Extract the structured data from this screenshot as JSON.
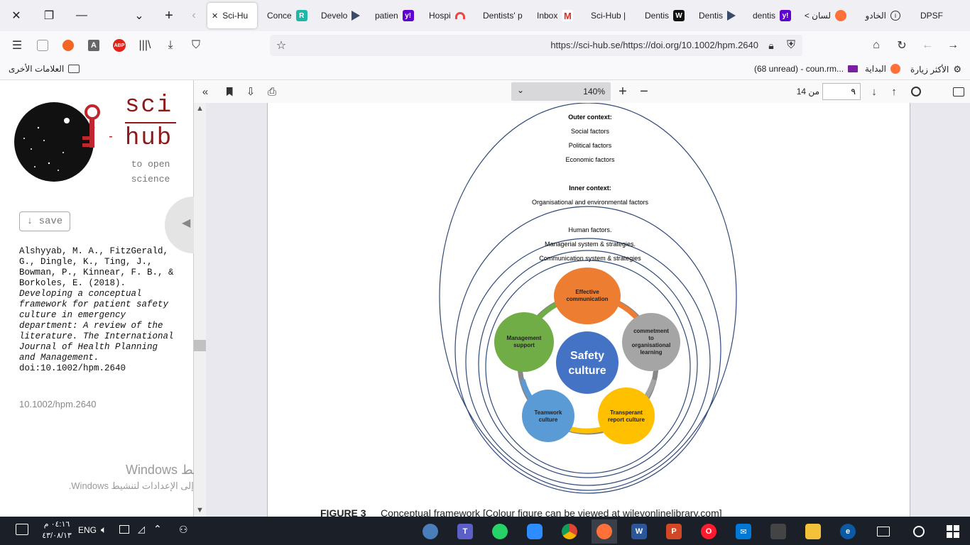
{
  "tabs": [
    {
      "label": "Sci-Hu",
      "active": true
    },
    {
      "label": "Conce",
      "favtext": "R"
    },
    {
      "label": "Develo"
    },
    {
      "label": "patien",
      "favtext": "y!"
    },
    {
      "label": "Hospi"
    },
    {
      "label": "Dentists' p"
    },
    {
      "label": "Inbox",
      "favtext": "M"
    },
    {
      "label": "Sci-Hub |"
    },
    {
      "label": "Dentis",
      "favtext": "W"
    },
    {
      "label": "Dentis"
    },
    {
      "label": "dentis",
      "favtext": "y!"
    },
    {
      "label": "لسان >"
    },
    {
      "label": "الخادو"
    },
    {
      "label": "DPSF"
    }
  ],
  "url": "https://sci-hub.se/https://doi.org/10.1002/hpm.2640",
  "bookmarks": {
    "other": "العلامات الأخرى",
    "unread": "(68 unread) - coun.rm...",
    "start": "البداية",
    "most_visited": "الأكثر زيارة"
  },
  "sidebar": {
    "logo_line1": "sci",
    "logo_line2": "hub",
    "tagline1": "to open",
    "tagline2": "science",
    "save": "↓ save",
    "citation_authors": "Alshyyab, M. A., FitzGerald, G., Dingle, K., Ting, J., Bowman, P., Kinnear, F. B., & Borkoles, E. (2018).",
    "citation_title": "Developing a conceptual framework for patient safety culture in emergency department: A review of the literature. The International Journal of Health Planning and Management.",
    "citation_doi": "doi:10.1002/hpm.2640",
    "doi_link": "10.1002/hpm.2640",
    "activate_title": "تنشيط Windows",
    "activate_sub": "انتقل إلى الإعدادات لتنشيط Windows."
  },
  "pdf_toolbar": {
    "zoom": "140%",
    "page_current": "٩",
    "page_total": "من 14"
  },
  "figure": {
    "outer_title": "Outer context:",
    "outer_items": [
      "Social factors",
      "Political factors",
      "Economic factors"
    ],
    "inner_title": "Inner context:",
    "inner_items": [
      "Organisational and environmental factors"
    ],
    "human_items": [
      "Human factors.",
      "Managerial system & strategies.",
      "Communication system & strategies"
    ],
    "center": [
      "Safety",
      "culture"
    ],
    "nodes": [
      {
        "lines": [
          "Effective",
          "communication"
        ],
        "color": "#ed7d31"
      },
      {
        "lines": [
          "commetment",
          "to",
          "organisational",
          "learning"
        ],
        "color": "#a5a5a5"
      },
      {
        "lines": [
          "Transperant",
          "report culture"
        ],
        "color": "#ffc000"
      },
      {
        "lines": [
          "Teamwork",
          "culture"
        ],
        "color": "#5b9bd5"
      },
      {
        "lines": [
          "Management",
          "support"
        ],
        "color": "#70ad47"
      }
    ],
    "center_color": "#4472c4",
    "caption_label": "FIGURE 3",
    "caption_text": "Conceptual framework [Colour figure can be viewed at wileyonlinelibrary.com]"
  },
  "taskbar": {
    "lang": "ENG",
    "time": "٠٤:١٦ م",
    "date": "٤٣/٠٨/١٣"
  }
}
